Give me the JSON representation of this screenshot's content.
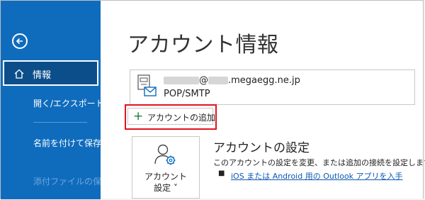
{
  "sidebar": {
    "items": [
      {
        "label": "情報",
        "active": true
      },
      {
        "label": "開く/エクスポート"
      },
      {
        "label": "名前を付けて保存"
      },
      {
        "label": "添付ファイルの保存",
        "disabled": true
      }
    ]
  },
  "main": {
    "title": "アカウント情報",
    "account": {
      "email_visible_prefix": "@",
      "email_domain": ".megaegg.ne.jp",
      "type": "POP/SMTP"
    },
    "add_account_label": "アカウントの追加",
    "settings_tile": {
      "line1": "アカウント",
      "line2": "設定 ˅"
    },
    "settings_section": {
      "title": "アカウントの設定",
      "description": "このアカウントの設定を変更、または追加の接続を設定します。",
      "bullet": "■",
      "link": "iOS または Android 用の Outlook アプリを入手"
    }
  },
  "colors": {
    "sidebar_bg": "#0f6cbd",
    "active_item_bg": "#0c4e8a",
    "highlight_outline": "#e0141c",
    "link": "#0b57b3",
    "add_plus": "#1a7f37"
  }
}
